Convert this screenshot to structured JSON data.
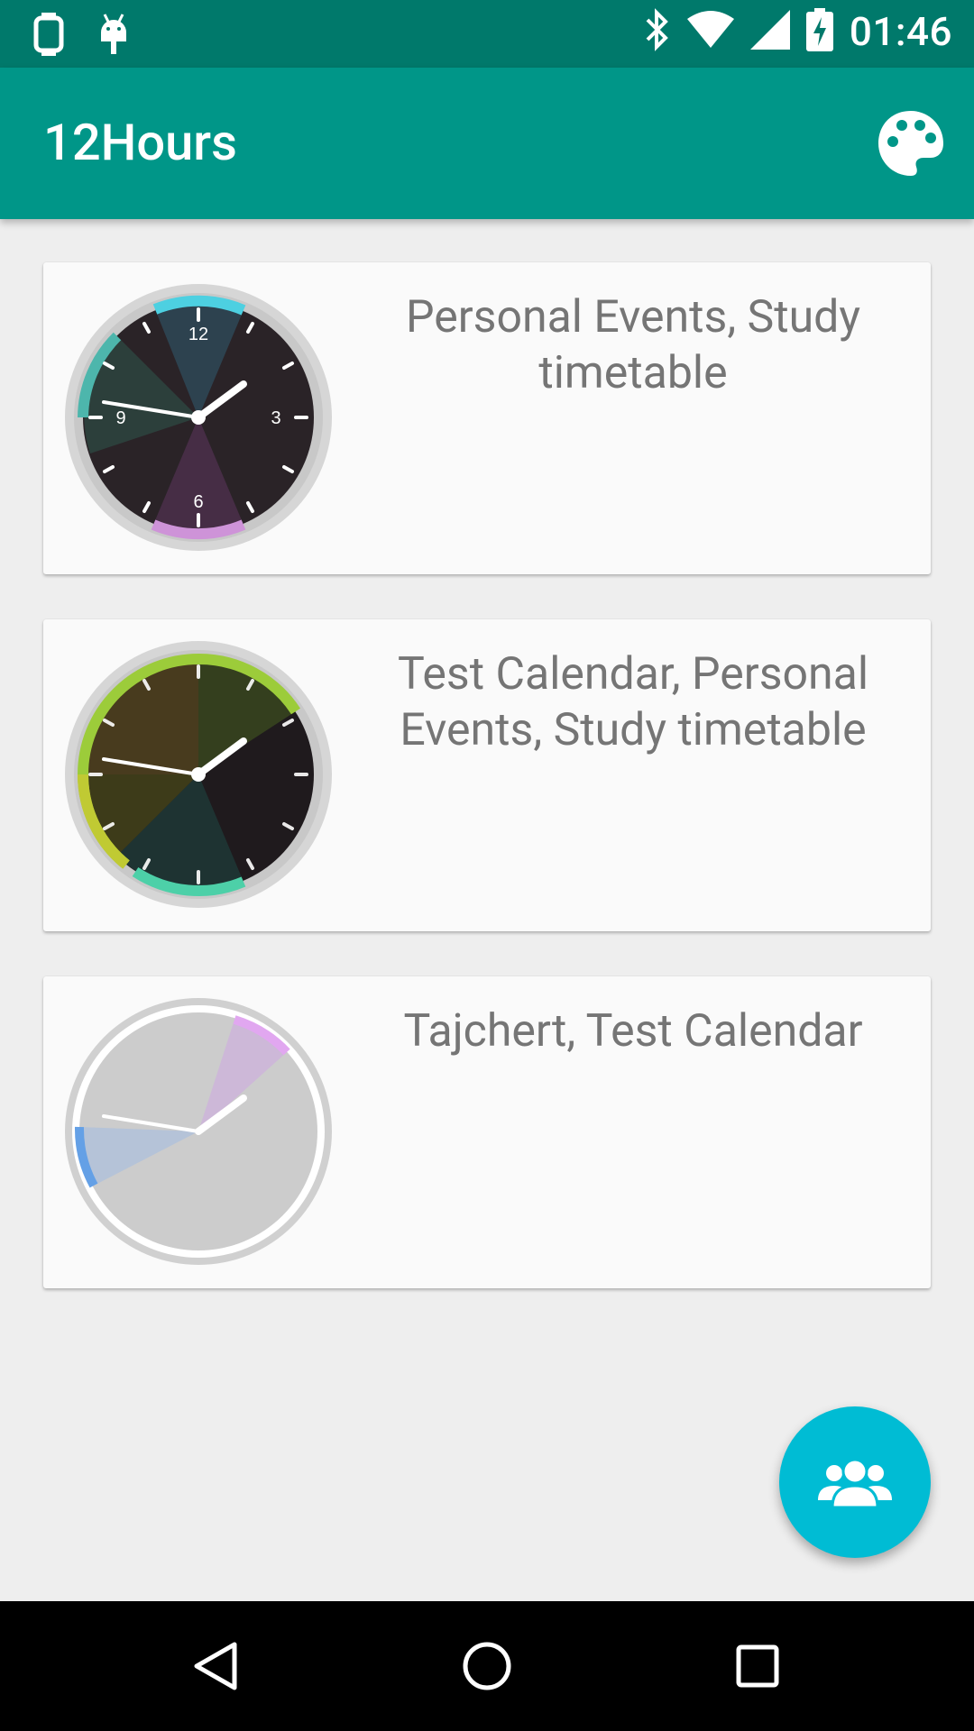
{
  "status_bar": {
    "time": "01:46",
    "left_icons": [
      "watch-icon",
      "android-debug-icon"
    ],
    "right_icons": [
      "bluetooth-icon",
      "wifi-icon",
      "cell-signal-icon",
      "battery-charging-icon"
    ]
  },
  "app_bar": {
    "title": "12Hours",
    "action_icon": "palette-icon",
    "color": "#009688"
  },
  "cards": [
    {
      "title": "Personal Events, Study timetable",
      "clock_style": "dark-numbered"
    },
    {
      "title": "Test Calendar, Personal Events, Study timetable",
      "clock_style": "dark-colorful"
    },
    {
      "title": "Tajchert, Test Calendar",
      "clock_style": "light-grey"
    }
  ],
  "fab": {
    "icon": "group-icon",
    "color": "#00BCD4"
  },
  "nav_bar": {
    "buttons": [
      "back-icon",
      "home-icon",
      "recents-icon"
    ]
  },
  "colors": {
    "status_bar": "#00796B",
    "background": "#EEEEEE",
    "card": "#FAFAFA",
    "text_secondary": "#757575"
  }
}
